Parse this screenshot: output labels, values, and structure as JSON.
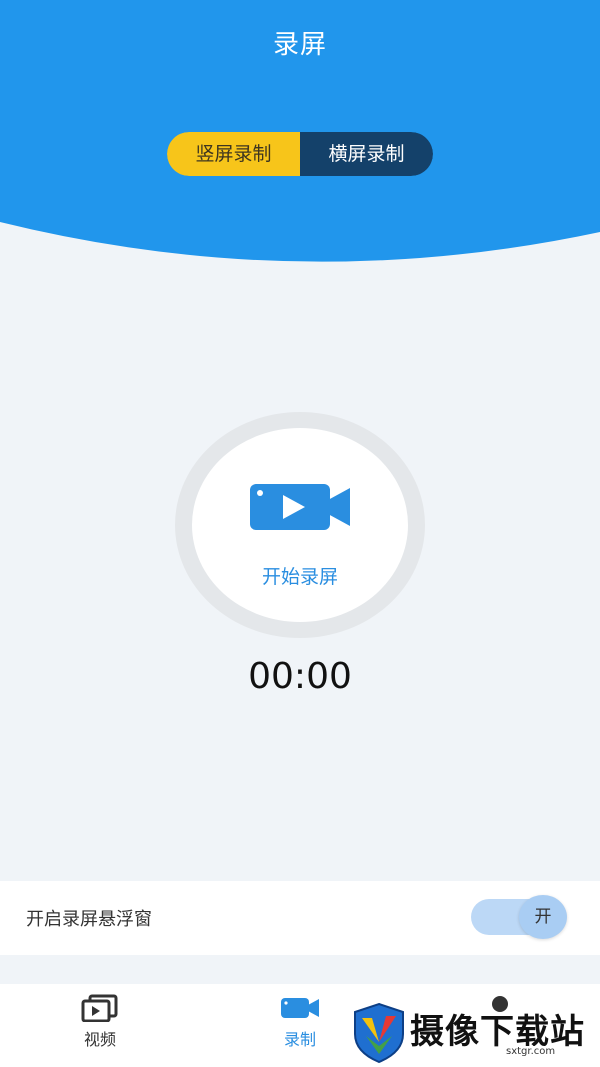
{
  "header": {
    "title": "录屏",
    "bg_color": "#2196ec"
  },
  "orientation_toggle": {
    "portrait_label": "竖屏录制",
    "landscape_label": "横屏录制",
    "selected": "portrait",
    "selected_color": "#f7c51a",
    "unselected_color": "#14416a"
  },
  "record_button": {
    "label": "开始录屏",
    "icon": "video-camera-icon",
    "accent": "#2a8ee0"
  },
  "timer": {
    "value": "00:00"
  },
  "floating_window": {
    "label": "开启录屏悬浮窗",
    "toggle_text": "开",
    "enabled": true
  },
  "bottom_nav": {
    "items": [
      {
        "label": "视频",
        "icon": "video-library-icon",
        "active": false
      },
      {
        "label": "录制",
        "icon": "video-camera-icon",
        "active": true
      }
    ]
  },
  "watermark": {
    "brand": "摄像下载站",
    "url": "sxtgr.com"
  }
}
